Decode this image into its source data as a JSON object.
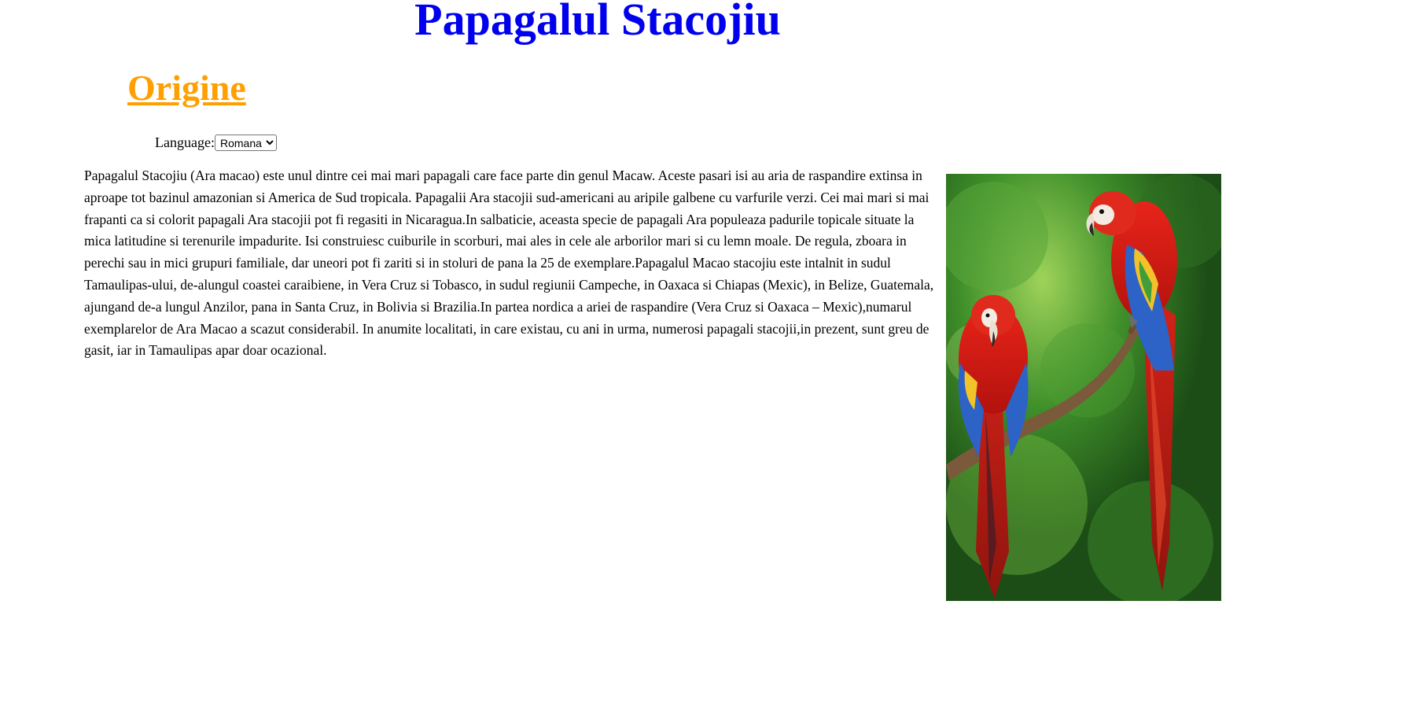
{
  "header": {
    "title": "Papagalul Stacojiu"
  },
  "section": {
    "heading": "Origine"
  },
  "language": {
    "label": "Language:",
    "selected": "Romana"
  },
  "article": {
    "text": "Papagalul Stacojiu (Ara macao) este unul dintre cei mai mari papagali care face parte din genul Macaw. Aceste pasari isi au aria de raspandire extinsa in aproape tot bazinul amazonian si America de Sud tropicala. Papagalii Ara stacojii sud-americani au aripile galbene cu varfurile verzi. Cei mai mari si mai frapanti ca si colorit papagali Ara stacojii pot fi regasiti in Nicaragua.In salbaticie, aceasta specie de papagali Ara populeaza padurile topicale situate la mica latitudine si terenurile impadurite. Isi construiesc cuiburile in scorburi, mai ales in cele ale arborilor mari si cu lemn moale. De regula, zboara in perechi sau in mici grupuri familiale, dar uneori pot fi zariti si in stoluri de pana la 25 de exemplare.Papagalul Macao stacojiu este intalnit in sudul Tamaulipas-ului, de-alungul coastei caraibiene, in Vera Cruz si Tobasco, in sudul regiunii Campeche, in Oaxaca si Chiapas (Mexic), in Belize, Guatemala, ajungand de-a lungul Anzilor, pana in Santa Cruz, in Bolivia si Brazilia.In partea nordica a ariei de raspandire (Vera Cruz si Oaxaca – Mexic),numarul exemplarelor de Ara Macao a scazut considerabil. In anumite localitati, in care existau, cu ani in urma, numerosi papagali stacojii,in prezent, sunt greu de gasit, iar in Tamaulipas apar doar ocazional."
  },
  "colors": {
    "title": "#0000ee",
    "heading": "#ff9f00",
    "text": "#000000",
    "background": "#ffffff"
  }
}
